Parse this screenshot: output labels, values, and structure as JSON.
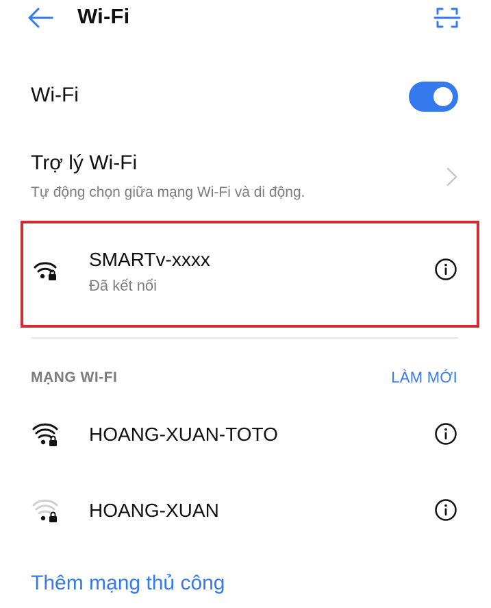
{
  "header": {
    "title": "Wi-Fi",
    "back_icon": "arrow-left-icon",
    "scan_icon": "scan-qr-icon"
  },
  "wifi_toggle": {
    "label": "Wi-Fi",
    "state": "on"
  },
  "assistant": {
    "title": "Trợ lý Wi-Fi",
    "subtitle": "Tự động chọn giữa mạng Wi-Fi và di động.",
    "icon": "chevron-right-icon"
  },
  "connected_network": {
    "name": "SMARTv-xxxx",
    "status": "Đã kết nối",
    "icon": "wifi-lock-icon",
    "highlight_color": "#d32a33"
  },
  "networks_section": {
    "title": "MẠNG WI-FI",
    "refresh_label": "LÀM MỚI",
    "items": [
      {
        "name": "HOANG-XUAN-TOTO",
        "icon": "wifi-lock-icon",
        "signal": "strong"
      },
      {
        "name": "HOANG-XUAN",
        "icon": "wifi-lock-weak-icon",
        "signal": "weak"
      }
    ]
  },
  "add_network_label": "Thêm mạng thủ công",
  "colors": {
    "accent": "#3479ee",
    "text": "#111111",
    "secondary_text": "#7d7d7d",
    "highlight": "#d32a33"
  }
}
